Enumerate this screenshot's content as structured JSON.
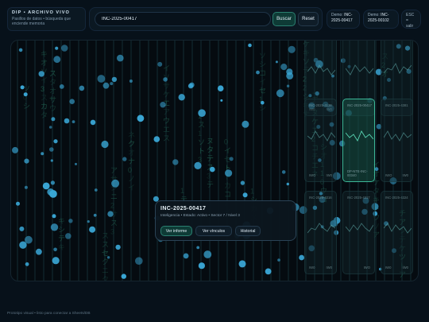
{
  "brand": {
    "title": "DIP • ARCHIVO VIVO",
    "subtitle": "Pasillos de datos • búsqueda que enciende memoria"
  },
  "search": {
    "value": "INC-2025-00417",
    "search_label": "Buscar",
    "reset_label": "Reset"
  },
  "chips": {
    "demo1_prefix": "Demo:",
    "demo1_value": "INC-2025-00417",
    "demo2_prefix": "Demo:",
    "demo2_value": "INC-2025-00102",
    "esc_line1": "ESC =",
    "esc_line2": "salir"
  },
  "cards": [
    {
      "id": "",
      "left": "IW0",
      "right": "IW0"
    },
    {
      "id": "",
      "left": "",
      "right": ""
    },
    {
      "id": "",
      "left": "",
      "right": ""
    },
    {
      "id": "INC-2025-4138",
      "left": "IWO",
      "right": "IW0"
    },
    {
      "id": "INC-2025-00417",
      "left": "DP-NTE-INC-00340",
      "right": ""
    },
    {
      "id": "INC-2025-4381",
      "left": "IWO",
      "right": "IW0"
    },
    {
      "id": "INC-2025-4316",
      "left": "IW0",
      "right": "IW0"
    },
    {
      "id": "INC-2025-4317",
      "left": "",
      "right": "IWO"
    },
    {
      "id": "INC-2025-4324",
      "left": "IW0",
      "right": "IW0"
    }
  ],
  "popup": {
    "title": "INC-2025-00417",
    "meta": "Inteligencia • Estado: Activo • Sector 7 / Nivel 3",
    "btn_report": "Ver informe",
    "btn_links": "Ver vínculos",
    "btn_history": "Historial"
  },
  "footer": "Prototipo visual • listo para conectar a Sheets/DB",
  "colors": {
    "accent": "#3fbf9e",
    "dot": "#3aa7d6",
    "background": "#07111a"
  }
}
